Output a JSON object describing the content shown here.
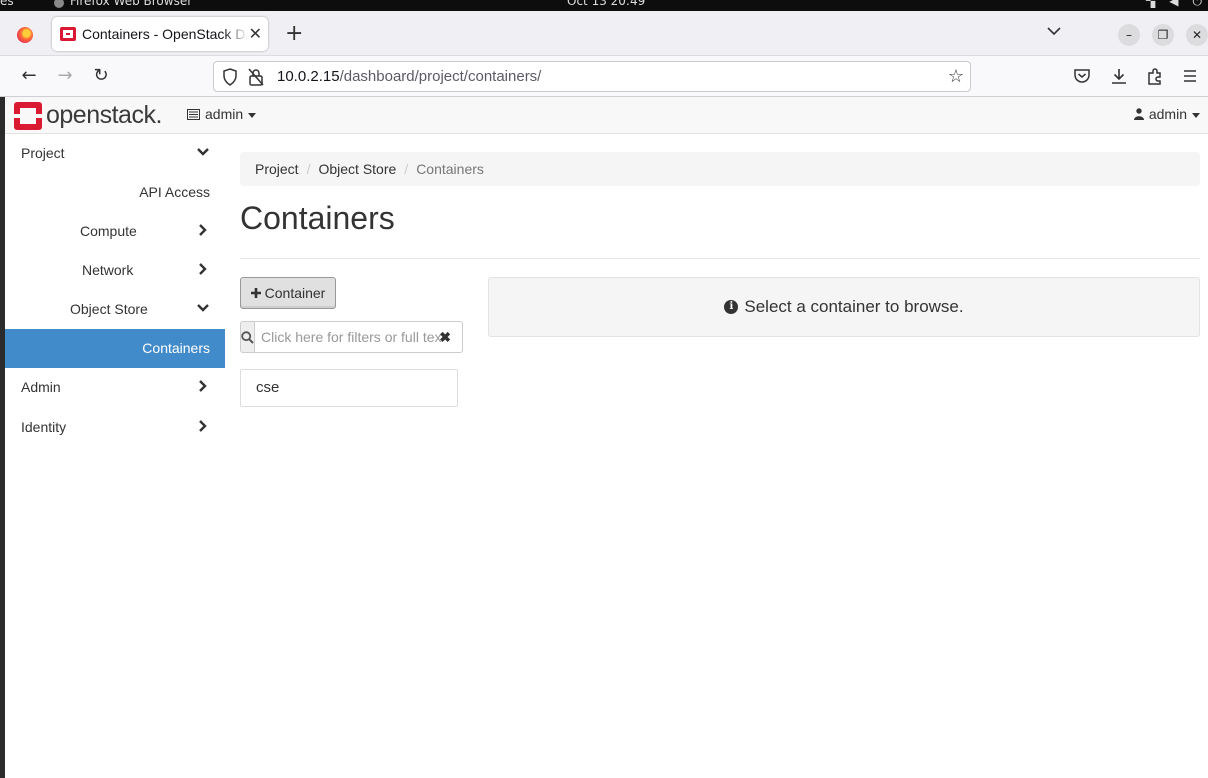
{
  "system_bar": {
    "activities": "es",
    "app_name": "Firefox Web Browser",
    "clock": "Oct 13  20:49"
  },
  "browser": {
    "tab_title": "Containers - OpenStack Dashboard",
    "url_host": "10.0.2.15",
    "url_path": "/dashboard/project/containers/"
  },
  "header": {
    "logo_text": "openstack.",
    "project_switcher": "admin",
    "user_menu": "admin"
  },
  "sidebar": {
    "items": [
      {
        "label": "Project"
      },
      {
        "label": "API Access"
      },
      {
        "label": "Compute"
      },
      {
        "label": "Network"
      },
      {
        "label": "Object Store"
      },
      {
        "label": "Containers"
      },
      {
        "label": "Admin"
      },
      {
        "label": "Identity"
      }
    ]
  },
  "breadcrumb": {
    "items": [
      "Project",
      "Object Store",
      "Containers"
    ]
  },
  "main": {
    "title": "Containers",
    "add_button": "Container",
    "search_placeholder": "Click here for filters or full text search.",
    "containers": [
      "cse"
    ],
    "browse_message": "Select a container to browse."
  },
  "colors": {
    "brand": "#da1a32",
    "active_nav": "#428bca"
  }
}
